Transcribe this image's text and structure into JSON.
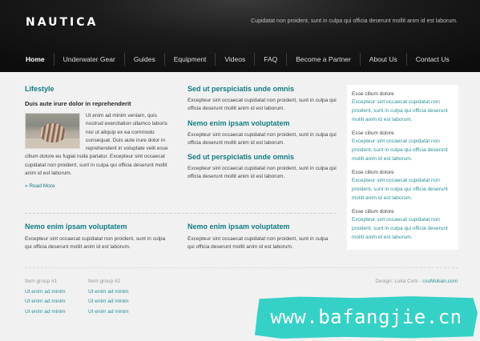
{
  "header": {
    "logo": "NAUTICA",
    "tagline": "Cupidatat non proident, sunt in culpa qui officia deserunt mollit anim id est laborum."
  },
  "nav": [
    "Home",
    "Underwater Gear",
    "Guides",
    "Equipment",
    "Videos",
    "FAQ",
    "Become a Partner",
    "About Us",
    "Contact Us"
  ],
  "lifestyle": {
    "title": "Lifestyle",
    "subtitle": "Duis aute irure dolor in reprehenderit",
    "text": "Ut enim ad minim veniam, quis nostrud exercitation ullamco laboris nisi ut aliquip ex ea commodo consequat. Duis aute irure dolor in reprehenderit in voluptate velit esse cillum dolore eu fugiat nulla pariatur. Excepteur sint occaecat cupidatat non proident, sunt in culpa qui officia deserunt mollit anim id est laborum.",
    "read_more": "» Read More",
    "image": "seashell-photo"
  },
  "middle": [
    {
      "title": "Sed ut perspiciatis unde omnis",
      "text": "Excepteur sint occaecat cupidatat non proident, sunt in culpa qui officia deserunt mollit anim id est laborum."
    },
    {
      "title": "Nemo enim ipsam voluptatem",
      "text": "Excepteur sint occaecat cupidatat non proident, sunt in culpa qui officia deserunt mollit anim id est laborum."
    },
    {
      "title": "Sed ut perspiciatis unde omnis",
      "text": "Excepteur sint occaecat cupidatat non proident, sunt in culpa qui officia deserunt mollit anim id est laborum."
    }
  ],
  "sidebar": [
    {
      "title": "Esse cillum dolore",
      "text": "Excepteur sint occaecat cupidatat non proident, sunt in culpa qui officia deserunt mollit anim id est laborum."
    },
    {
      "title": "Esse cillum dolore",
      "text": "Excepteur sint occaecat cupidatat non proident, sunt in culpa qui officia deserunt mollit anim id est laborum."
    },
    {
      "title": "Esse cillum dolore",
      "text": "Excepteur sint occaecat cupidatat non proident, sunt in culpa qui officia deserunt mollit anim id est laborum."
    },
    {
      "title": "Esse cillum dolore",
      "text": "Excepteur sint occaecat cupidatat non proident, sunt in culpa qui officia deserunt mollit anim id est laborum."
    }
  ],
  "bottom": [
    {
      "title": "Nemo enim ipsam voluptatem",
      "text": "Excepteur sint occaecat cupidatat non proident, sunt in culpa qui officia deserunt mollit anim id est laborum."
    },
    {
      "title": "Nemo enim ipsam voluptatem",
      "text": "Excepteur sint occaecat cupidatat non proident, sunt in culpa qui officia deserunt mollit anim id est laborum."
    }
  ],
  "footer": {
    "groups": [
      {
        "title": "Item group #1",
        "links": [
          "Ut enim ad minim",
          "Ut enim ad minim",
          "Ut enim ad minim"
        ]
      },
      {
        "title": "Item group #2",
        "links": [
          "Ut enim ad minim",
          "Ut enim ad minim",
          "Ut enim ad minim"
        ]
      }
    ],
    "credit_prefix": "Design: Luka Cvrk - ",
    "credit_link": "cssMoban.com"
  },
  "watermark": "www.bafangjie.cn",
  "colors": {
    "accent": "#127c82",
    "link": "#2a9197",
    "header_bg": "#111111",
    "page_bg": "#f1f1f1"
  }
}
